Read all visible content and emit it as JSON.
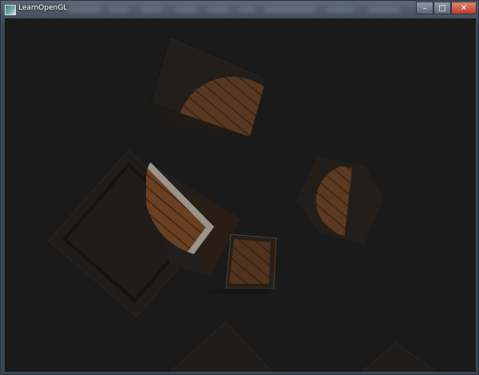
{
  "window": {
    "title": "LearnOpenGL",
    "controls": {
      "minimize": "–",
      "maximize": "□",
      "close": "✕"
    },
    "icons": {
      "app": "opengl-app-icon",
      "minimize": "minimize-icon",
      "maximize": "maximize-icon",
      "close": "close-icon"
    }
  },
  "scene": {
    "background_color": "#1a1a1a",
    "crate_dark_color": "#221e1b",
    "crate_lit_color": "#6a4022",
    "metal_edge_color": "#9a948c",
    "frame_color": "#3b4654"
  }
}
